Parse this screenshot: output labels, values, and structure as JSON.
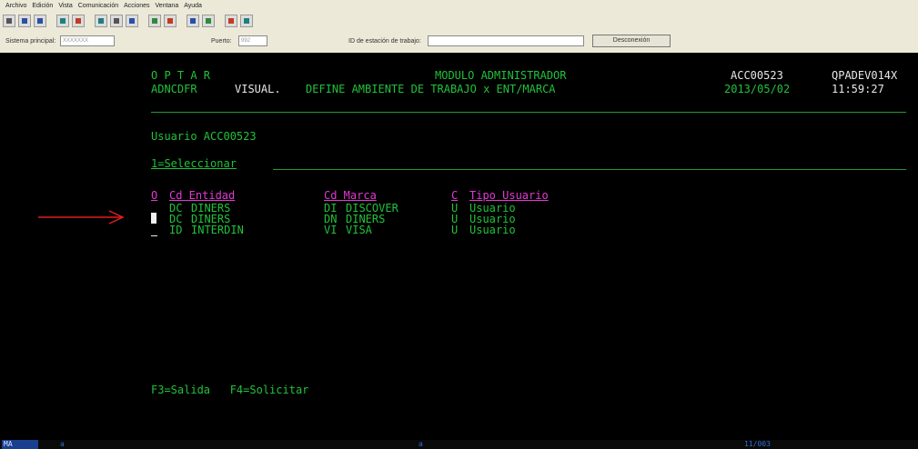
{
  "menu": [
    "Archivo",
    "Edición",
    "Vista",
    "Comunicación",
    "Acciones",
    "Ventana",
    "Ayuda"
  ],
  "toolbar_icons": [
    "print-icon",
    "copy-icon",
    "paste-icon",
    "send-icon",
    "receive-icon",
    "macro-icon",
    "macro2-icon",
    "color-icon",
    "keyboard-icon",
    "transfer-icon",
    "transfer2-icon",
    "display-icon",
    "display2-icon",
    "globe-icon",
    "settings-icon"
  ],
  "session": {
    "system_label": "Sistema principal:",
    "system_value": "XXXXXXX",
    "port_label": "Puerto:",
    "port_value": "992",
    "station_label": "ID de estación de trabajo:",
    "station_value": "",
    "disconnect_label": "Desconexión"
  },
  "screen": {
    "line1_left": "O P T A R",
    "line1_center": "MODULO ADMINISTRADOR",
    "line1_user": "ACC00523",
    "line1_device": "QPADEV014X",
    "line2_program": "ADNCDFR",
    "line2_mode": "VISUAL.",
    "line2_title": "DEFINE AMBIENTE DE TRABAJO x ENT/MARCA",
    "line2_date": "2013/05/02",
    "line2_time": "11:59:27",
    "user_line": "Usuario ACC00523",
    "option_hint": "1=Seleccionar",
    "headers": {
      "opt": "O",
      "entity": "Cd Entidad",
      "brand": "Cd Marca",
      "type_code": "C",
      "type": "Tipo Usuario"
    },
    "rows": [
      {
        "entity_code": "DC",
        "entity": "DINERS",
        "brand_code": "DI",
        "brand": "DISCOVER",
        "type_code": "U",
        "type": "Usuario"
      },
      {
        "entity_code": "DC",
        "entity": "DINERS",
        "brand_code": "DN",
        "brand": "DINERS",
        "type_code": "U",
        "type": "Usuario"
      },
      {
        "entity_code": "ID",
        "entity": "INTERDIN",
        "brand_code": "VI",
        "brand": "VISA",
        "type_code": "U",
        "type": "Usuario"
      }
    ],
    "fkeys": "F3=Salida   F4=Solicitar"
  },
  "status": {
    "mode": "MA",
    "mid1": "a",
    "mid2": "a",
    "pos": "11/003"
  },
  "colors": {
    "terminal_bg": "#000000",
    "green_text": "#21c23a",
    "pink_text": "#e23ad2",
    "white_text": "#e8e8e8",
    "arrow": "#e01e1e"
  }
}
